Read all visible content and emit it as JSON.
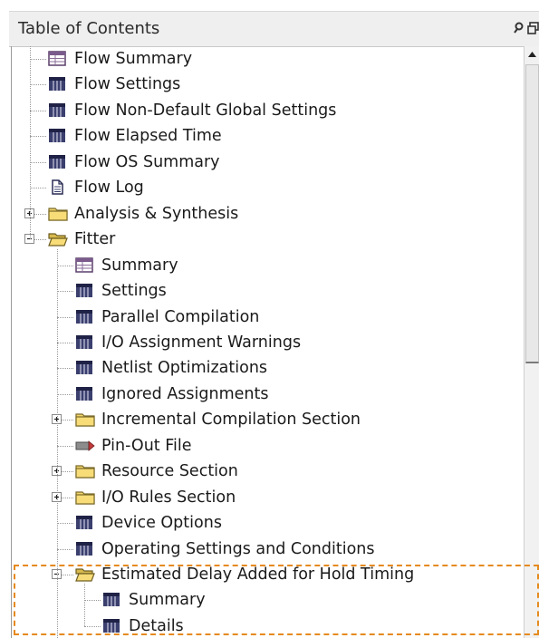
{
  "header": {
    "title": "Table of Contents"
  },
  "tree": [
    {
      "label": "Flow Summary",
      "icon": "summary-table-icon",
      "level": 0,
      "name": "flow-summary"
    },
    {
      "label": "Flow Settings",
      "icon": "grid-table-icon",
      "level": 0,
      "name": "flow-settings"
    },
    {
      "label": "Flow Non-Default Global Settings",
      "icon": "grid-table-icon",
      "level": 0,
      "name": "flow-non-default-global-settings"
    },
    {
      "label": "Flow Elapsed Time",
      "icon": "grid-table-icon",
      "level": 0,
      "name": "flow-elapsed-time"
    },
    {
      "label": "Flow OS Summary",
      "icon": "grid-table-icon",
      "level": 0,
      "name": "flow-os-summary"
    },
    {
      "label": "Flow Log",
      "icon": "document-icon",
      "level": 0,
      "name": "flow-log"
    },
    {
      "label": "Analysis & Synthesis",
      "icon": "folder-closed-icon",
      "level": 0,
      "expander": "+",
      "name": "analysis-synthesis"
    },
    {
      "label": "Fitter",
      "icon": "folder-open-icon",
      "level": 0,
      "expander": "-",
      "name": "fitter"
    },
    {
      "label": "Summary",
      "icon": "summary-table-icon",
      "level": 1,
      "name": "fitter-summary"
    },
    {
      "label": "Settings",
      "icon": "grid-table-icon",
      "level": 1,
      "name": "fitter-settings"
    },
    {
      "label": "Parallel Compilation",
      "icon": "grid-table-icon",
      "level": 1,
      "name": "parallel-compilation"
    },
    {
      "label": "I/O Assignment Warnings",
      "icon": "grid-table-icon",
      "level": 1,
      "name": "io-assignment-warnings"
    },
    {
      "label": "Netlist Optimizations",
      "icon": "grid-table-icon",
      "level": 1,
      "name": "netlist-optimizations"
    },
    {
      "label": "Ignored Assignments",
      "icon": "grid-table-icon",
      "level": 1,
      "name": "ignored-assignments"
    },
    {
      "label": "Incremental Compilation Section",
      "icon": "folder-closed-icon",
      "level": 1,
      "expander": "+",
      "name": "incremental-compilation-section"
    },
    {
      "label": "Pin-Out File",
      "icon": "pin-file-icon",
      "level": 1,
      "name": "pin-out-file"
    },
    {
      "label": "Resource Section",
      "icon": "folder-closed-icon",
      "level": 1,
      "expander": "+",
      "name": "resource-section"
    },
    {
      "label": "I/O Rules Section",
      "icon": "folder-closed-icon",
      "level": 1,
      "expander": "+",
      "name": "io-rules-section"
    },
    {
      "label": "Device Options",
      "icon": "grid-table-icon",
      "level": 1,
      "name": "device-options"
    },
    {
      "label": "Operating Settings and Conditions",
      "icon": "grid-table-icon",
      "level": 1,
      "name": "operating-settings-and-conditions"
    },
    {
      "label": "Estimated Delay Added for Hold Timing",
      "icon": "folder-open-icon",
      "level": 1,
      "expander": "-",
      "name": "estimated-delay-added-for-hold-timing"
    },
    {
      "label": "Summary",
      "icon": "grid-table-icon",
      "level": 2,
      "name": "hold-timing-summary"
    },
    {
      "label": "Details",
      "icon": "grid-table-icon",
      "level": 2,
      "name": "hold-timing-details"
    }
  ]
}
